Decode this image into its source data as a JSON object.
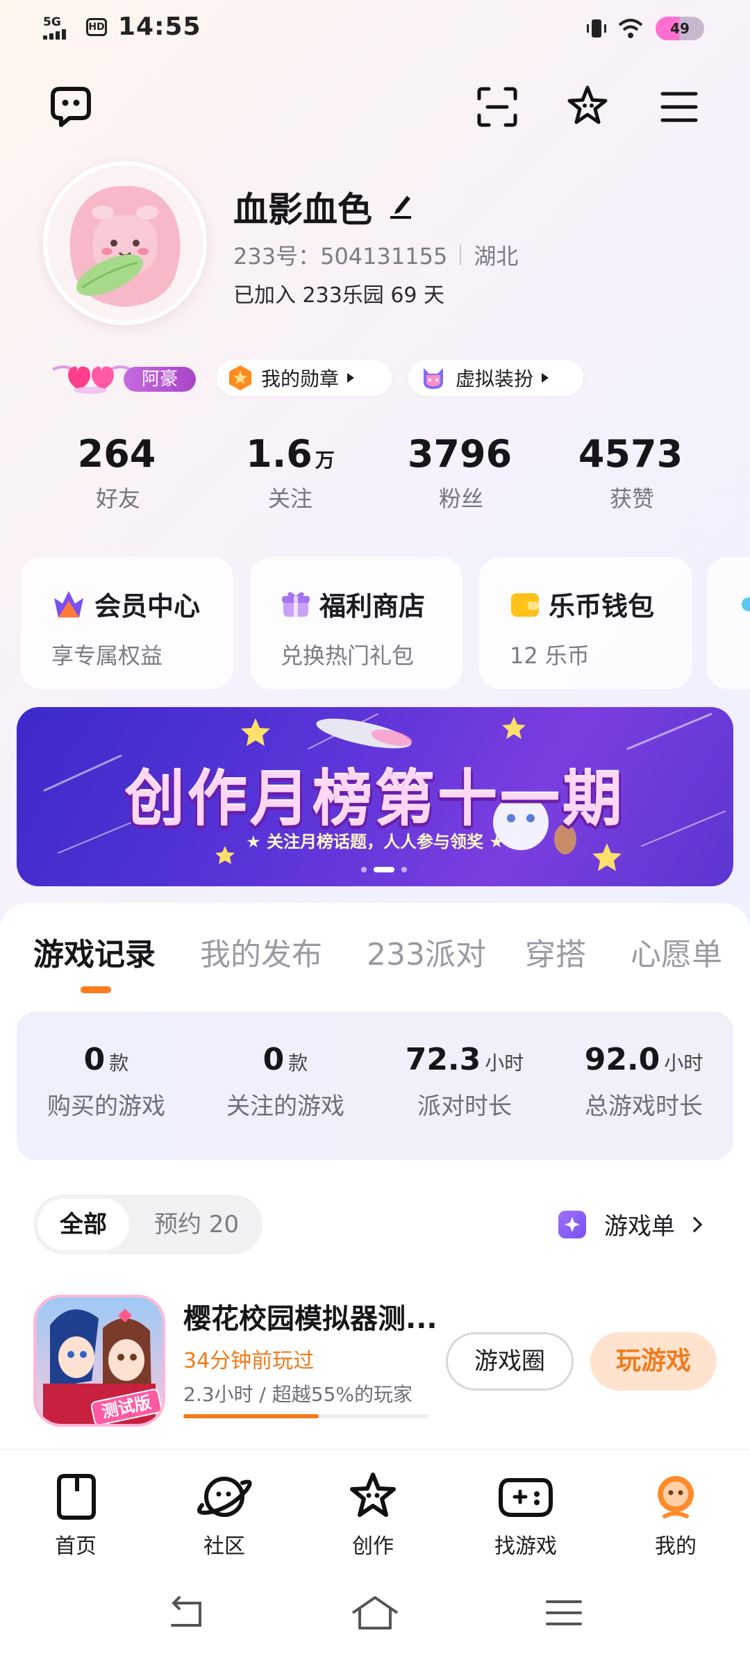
{
  "status_bar": {
    "network": "5G",
    "hd": "HD",
    "time": "14:55",
    "battery": "49"
  },
  "top_bar": {
    "icons": [
      "chat-icon",
      "scan-icon",
      "star-icon",
      "menu-icon"
    ]
  },
  "profile": {
    "username": "血影血色",
    "uid": "233号：504131155",
    "region": "湖北",
    "joined": "已加入 233乐园 69 天"
  },
  "tags": {
    "vip_label": "阿豪",
    "medals_label": "我的勋章",
    "avatar_dressup_label": "虚拟装扮"
  },
  "stats": [
    {
      "value": "264",
      "unit": "",
      "label": "好友"
    },
    {
      "value": "1.6",
      "unit": "万",
      "label": "关注"
    },
    {
      "value": "3796",
      "unit": "",
      "label": "粉丝"
    },
    {
      "value": "4573",
      "unit": "",
      "label": "获赞"
    }
  ],
  "cards": [
    {
      "title": "会员中心",
      "subtitle": "享专属权益"
    },
    {
      "title": "福利商店",
      "subtitle": "兑换热门礼包"
    },
    {
      "title": "乐币钱包",
      "subtitle": "12 乐币"
    }
  ],
  "banner": {
    "title": "创作月榜第十一期",
    "subtitle": "★ 关注月榜话题，人人参与领奖 ★",
    "page_index": 2,
    "page_count": 3
  },
  "tabs": [
    "游戏记录",
    "我的发布",
    "233派对",
    "穿搭",
    "心愿单"
  ],
  "active_tab": 0,
  "game_stats": [
    {
      "value": "0",
      "unit": "款",
      "label": "购买的游戏"
    },
    {
      "value": "0",
      "unit": "款",
      "label": "关注的游戏"
    },
    {
      "value": "72.3",
      "unit": "小时",
      "label": "派对时长"
    },
    {
      "value": "92.0",
      "unit": "小时",
      "label": "总游戏时长"
    }
  ],
  "filter": {
    "all": "全部",
    "reserved": "预约 20",
    "game_list": "游戏单"
  },
  "game": {
    "title": "樱花校园模拟器测...",
    "last_played": "34分钟前玩过",
    "play_stats": "2.3小时 / 超越55%的玩家",
    "progress": 0.55,
    "badge": "测试版",
    "circle_button": "游戏圈",
    "play_button": "玩游戏"
  },
  "bottom_nav": [
    {
      "label": "首页",
      "icon": "home-icon"
    },
    {
      "label": "社区",
      "icon": "planet-icon"
    },
    {
      "label": "创作",
      "icon": "star-face-icon"
    },
    {
      "label": "找游戏",
      "icon": "gamepad-icon"
    },
    {
      "label": "我的",
      "icon": "profile-icon"
    }
  ],
  "active_nav": 4,
  "colors": {
    "accent": "#f07b1c",
    "vip_purple": "#b24fd4",
    "banner_bg": "#4a2fd2"
  }
}
